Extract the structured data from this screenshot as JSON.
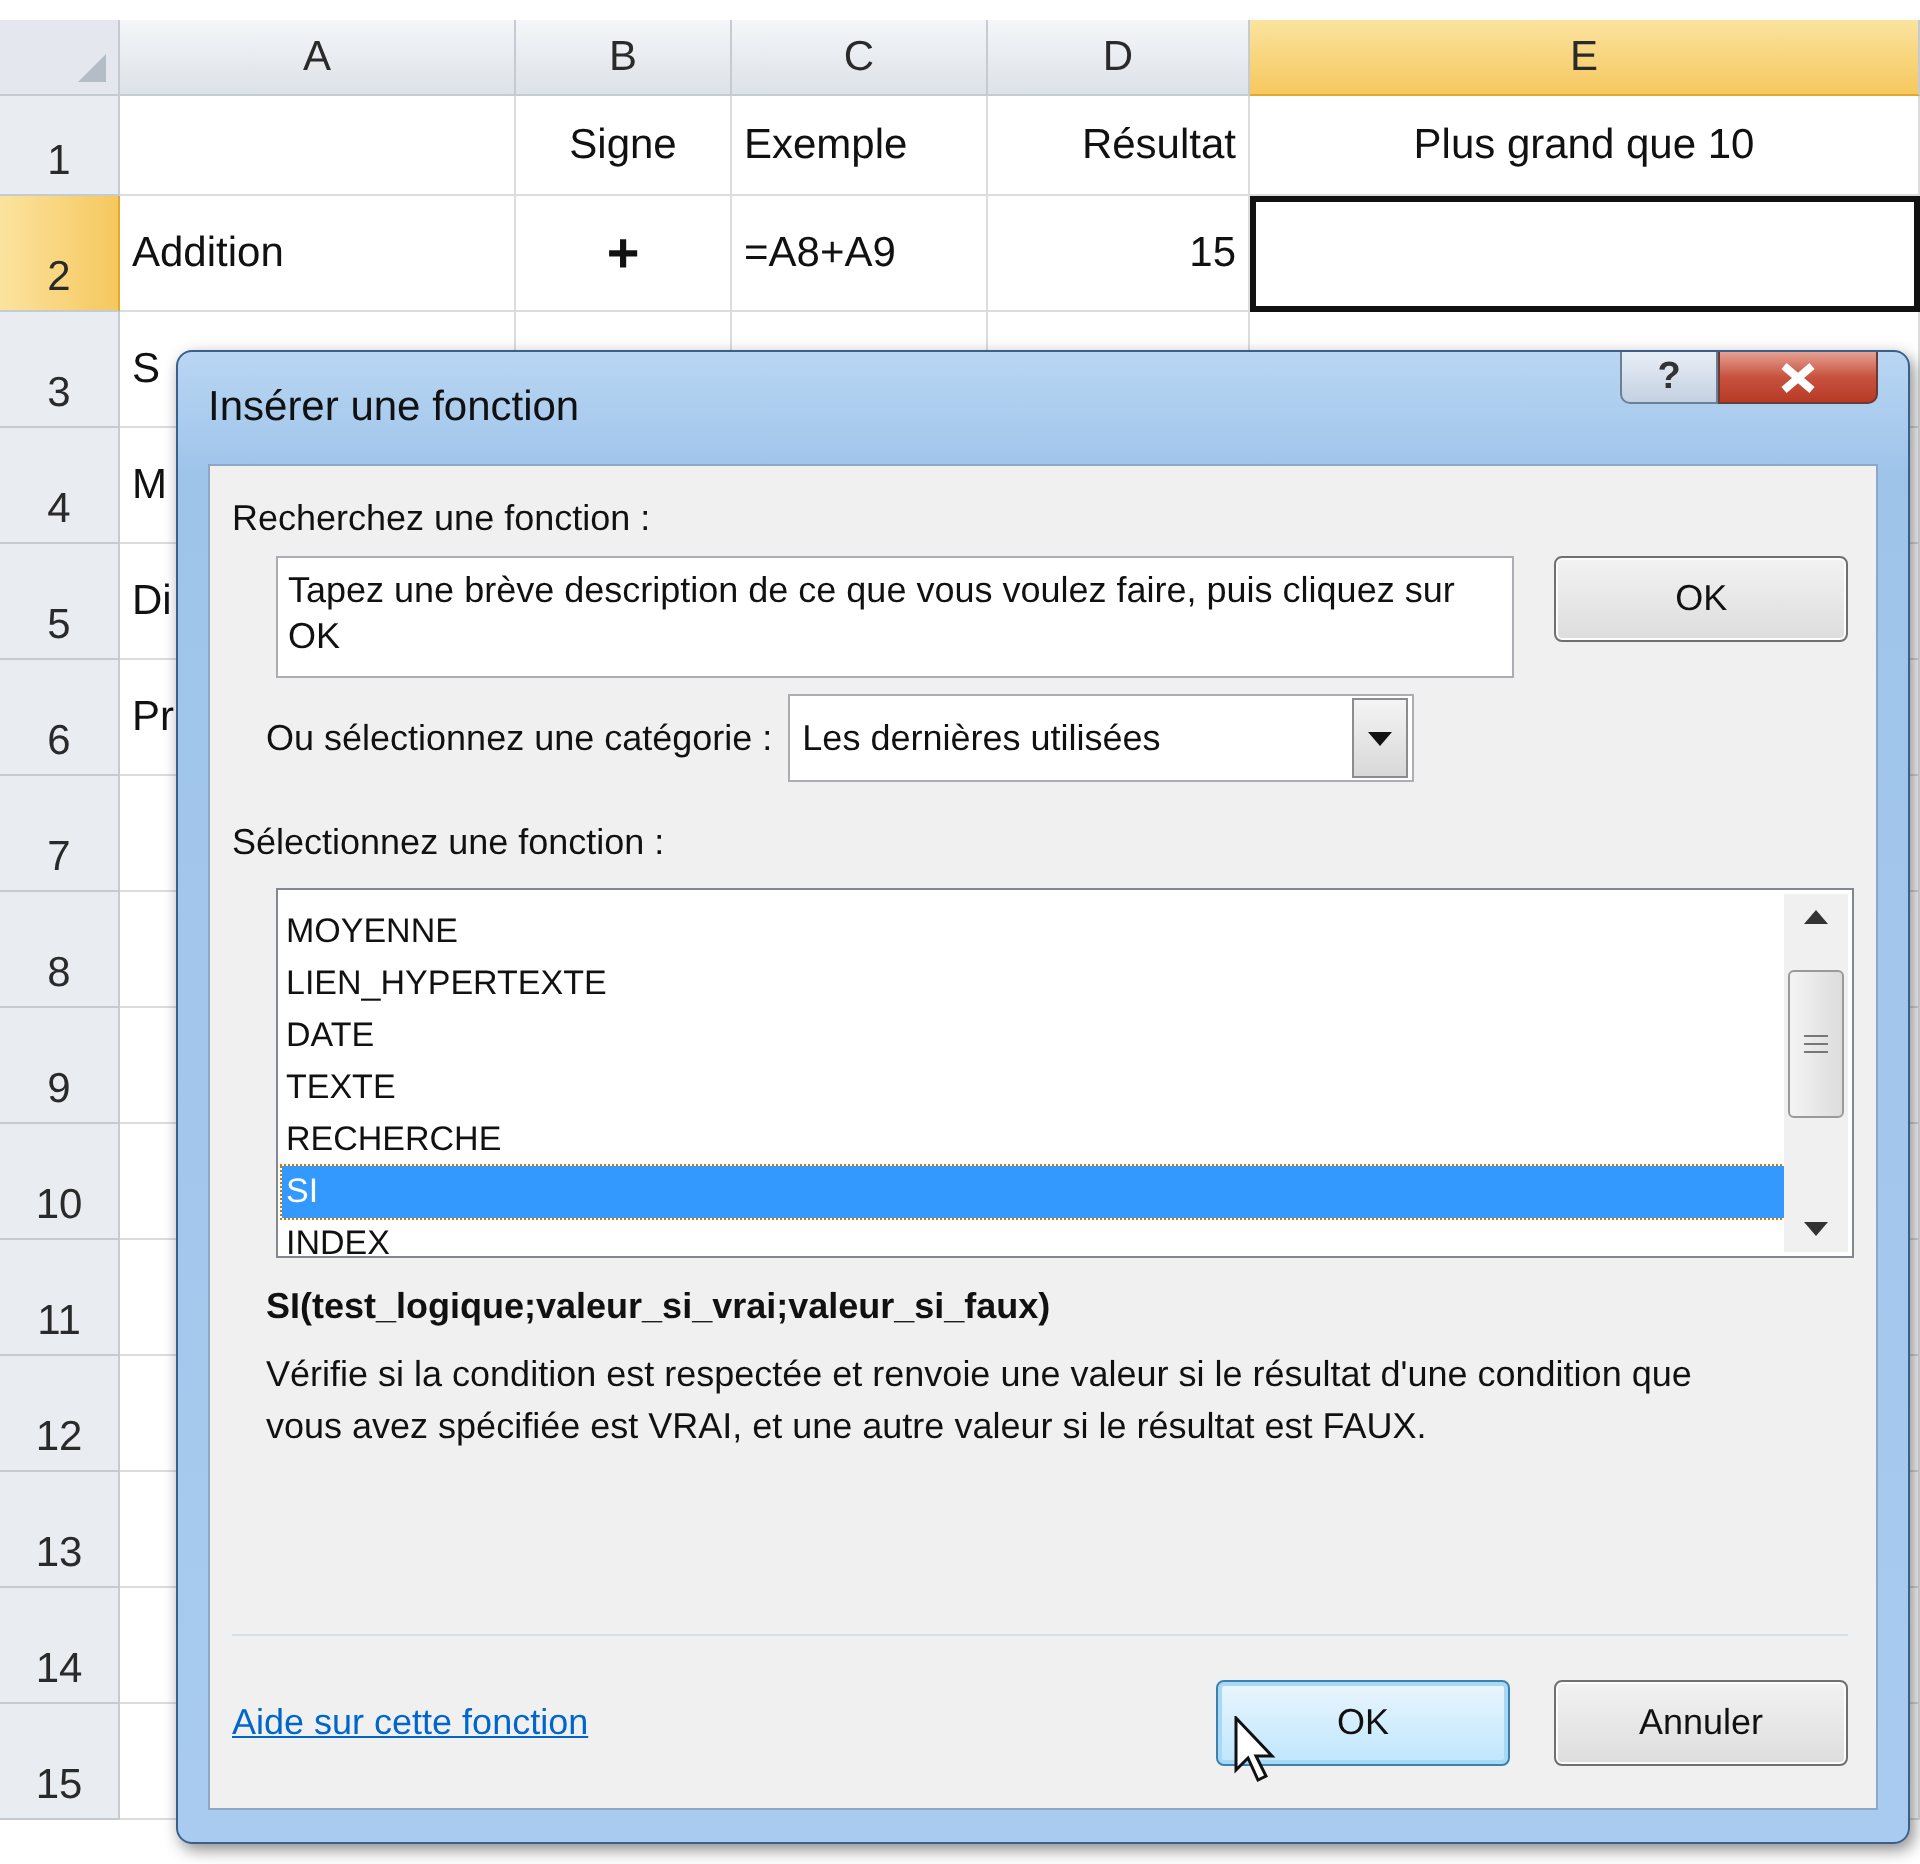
{
  "sheet": {
    "columns": [
      {
        "label": "A",
        "selected": false
      },
      {
        "label": "B",
        "selected": false
      },
      {
        "label": "C",
        "selected": false
      },
      {
        "label": "D",
        "selected": false
      },
      {
        "label": "E",
        "selected": true
      }
    ],
    "rows": [
      {
        "number": "1",
        "selected": false,
        "b": "Signe",
        "c": "Exemple",
        "d": "Résultat",
        "e": "Plus grand que 10"
      },
      {
        "number": "2",
        "selected": true,
        "a": "Addition",
        "b": "+",
        "b_symbol": true,
        "c": "=A8+A9",
        "d": "15"
      },
      {
        "number": "3",
        "selected": false,
        "a": "S"
      },
      {
        "number": "4",
        "selected": false,
        "a": "M"
      },
      {
        "number": "5",
        "selected": false,
        "a": "Di"
      },
      {
        "number": "6",
        "selected": false,
        "a": "Pr"
      },
      {
        "number": "7",
        "selected": false
      },
      {
        "number": "8",
        "selected": false
      },
      {
        "number": "9",
        "selected": false
      },
      {
        "number": "10",
        "selected": false
      },
      {
        "number": "11",
        "selected": false
      },
      {
        "number": "12",
        "selected": false
      },
      {
        "number": "13",
        "selected": false
      },
      {
        "number": "14",
        "selected": false
      },
      {
        "number": "15",
        "selected": false
      }
    ]
  },
  "dialog": {
    "title": "Insérer une fonction",
    "help_button": "?",
    "search": {
      "label": "Recherchez une fonction :",
      "value": "Tapez une brève description de ce que vous voulez faire, puis cliquez sur OK",
      "button": "OK"
    },
    "category": {
      "label": "Ou sélectionnez une catégorie :",
      "value": "Les dernières utilisées"
    },
    "functions": {
      "label": "Sélectionnez une fonction :",
      "items": [
        {
          "name": "MOYENNE",
          "selected": false
        },
        {
          "name": "LIEN_HYPERTEXTE",
          "selected": false
        },
        {
          "name": "DATE",
          "selected": false
        },
        {
          "name": "TEXTE",
          "selected": false
        },
        {
          "name": "RECHERCHE",
          "selected": false
        },
        {
          "name": "SI",
          "selected": true
        },
        {
          "name": "INDEX",
          "selected": false
        }
      ]
    },
    "signature": "SI(test_logique;valeur_si_vrai;valeur_si_faux)",
    "description": "Vérifie si la condition est respectée et renvoie une valeur si le résultat d'une condition que vous avez spécifiée est VRAI, et une autre valeur si le résultat est FAUX.",
    "help_link": "Aide sur cette fonction",
    "buttons": [
      {
        "label": "OK",
        "focused": true
      },
      {
        "label": "Annuler",
        "focused": false
      }
    ]
  }
}
